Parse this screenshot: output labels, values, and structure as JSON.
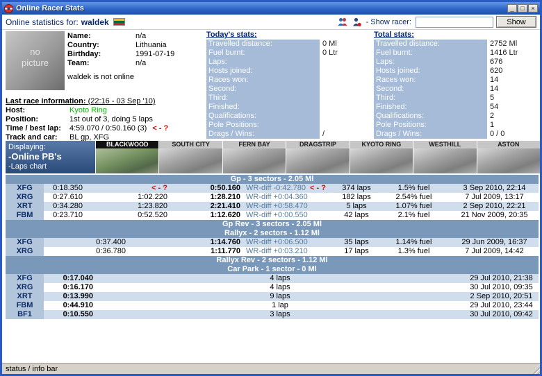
{
  "window": {
    "title": "Online Racer Stats",
    "min_label": "_",
    "max_label": "□",
    "close_label": "×"
  },
  "toolbar": {
    "label": "Online statistics for:",
    "racer_name": "waldek",
    "show_racer_label": "- Show racer:",
    "search_value": "",
    "show_button_label": "Show"
  },
  "profile": {
    "no_picture_line1": "no",
    "no_picture_line2": "picture",
    "fields": [
      {
        "label": "Name:",
        "value": "n/a"
      },
      {
        "label": "Country:",
        "value": "Lithuania"
      },
      {
        "label": "Birthday:",
        "value": "1991-07-19"
      },
      {
        "label": "Team:",
        "value": "n/a"
      }
    ],
    "online_status": "waldek is not online"
  },
  "last_race": {
    "title": "Last race information:",
    "timestamp": "(22:16 - 03 Sep '10)",
    "host_label": "Host:",
    "host_value": "Kyoto Ring",
    "position_label": "Position:",
    "position_value": "1st out of 3, doing 5 laps",
    "time_label": "Time / best lap:",
    "time_value": "4:59.070 / 0:50.160 (3)",
    "time_annotation": "< - ?",
    "track_label": "Track and car:",
    "track_value": "BL gp, XFG"
  },
  "todays_stats": {
    "title": "Today's stats:",
    "rows": [
      {
        "label": "Travelled distance:",
        "value": "0 Ml"
      },
      {
        "label": "Fuel burnt:",
        "value": "0 Ltr"
      },
      {
        "label": "Laps:",
        "value": ""
      },
      {
        "label": "Hosts joined:",
        "value": ""
      },
      {
        "label": "Races won:",
        "value": ""
      },
      {
        "label": "Second:",
        "value": ""
      },
      {
        "label": "Third:",
        "value": ""
      },
      {
        "label": "Finished:",
        "value": ""
      },
      {
        "label": "Qualifications:",
        "value": ""
      },
      {
        "label": "Pole Positions:",
        "value": ""
      },
      {
        "label": "Drags / Wins:",
        "value": "/"
      }
    ]
  },
  "total_stats": {
    "title": "Total stats:",
    "rows": [
      {
        "label": "Travelled distance:",
        "value": "2752 Ml"
      },
      {
        "label": "Fuel burnt:",
        "value": "1416 Ltr"
      },
      {
        "label": "Laps:",
        "value": "676"
      },
      {
        "label": "Hosts joined:",
        "value": "620"
      },
      {
        "label": "Races won:",
        "value": "14"
      },
      {
        "label": "Second:",
        "value": "14"
      },
      {
        "label": "Third:",
        "value": "5"
      },
      {
        "label": "Finished:",
        "value": "54"
      },
      {
        "label": "Qualifications:",
        "value": "2"
      },
      {
        "label": "Pole Positions:",
        "value": "1"
      },
      {
        "label": "Drags / Wins:",
        "value": "0 / 0"
      }
    ]
  },
  "displaying": {
    "label": "Displaying:",
    "item1": "-Online PB's",
    "item2": "-Laps chart"
  },
  "tracks": [
    {
      "name": "BLACKWOOD"
    },
    {
      "name": "SOUTH CITY"
    },
    {
      "name": "FERN BAY"
    },
    {
      "name": "DRAGSTRIP"
    },
    {
      "name": "KYOTO RING"
    },
    {
      "name": "WESTHILL"
    },
    {
      "name": "ASTON"
    }
  ],
  "results": {
    "sections": [
      {
        "header": "Gp - 3 sectors - 2.05 Ml",
        "rows": [
          {
            "car": "XFG",
            "s1": "0:18.350",
            "s2": "",
            "s2_annotation": "< - ?",
            "lap": "0:50.160",
            "wr": "WR-diff -0:42.780",
            "wr_annotation": "< - ?",
            "laps": "374 laps",
            "fuel": "1.5% fuel",
            "date": "3 Sep 2010, 22:14"
          },
          {
            "car": "XRG",
            "s1": "0:27.610",
            "s2": "1:02.220",
            "lap": "1:28.210",
            "wr": "WR-diff +0:04.360",
            "laps": "182 laps",
            "fuel": "2.54% fuel",
            "date": "7 Jul 2009, 13:17"
          },
          {
            "car": "XRT",
            "s1": "0:34.280",
            "s2": "1:23.820",
            "lap": "2:21.410",
            "wr": "WR-diff +0:58.470",
            "laps": "5 laps",
            "fuel": "1.07% fuel",
            "date": "2 Sep 2010, 22:21"
          },
          {
            "car": "FBM",
            "s1": "0:23.710",
            "s2": "0:52.520",
            "lap": "1:12.620",
            "wr": "WR-diff +0:00.550",
            "laps": "42 laps",
            "fuel": "2.1% fuel",
            "date": "21 Nov 2009, 20:35"
          }
        ]
      },
      {
        "header": "Gp Rev - 3 sectors - 2.05 Ml",
        "rows": []
      },
      {
        "header": "Rallyx - 2 sectors - 1.12 Ml",
        "rows": [
          {
            "car": "XFG",
            "s1": "0:37.400",
            "lap": "1:14.760",
            "wr": "WR-diff +0:06.500",
            "laps": "35 laps",
            "fuel": "1.14% fuel",
            "date": "29 Jun 2009, 16:37"
          },
          {
            "car": "XRG",
            "s1": "0:36.780",
            "lap": "1:11.770",
            "wr": "WR-diff +0:03.210",
            "laps": "17 laps",
            "fuel": "1.3% fuel",
            "date": "7 Jul 2009, 14:42"
          }
        ]
      },
      {
        "header": "Rallyx Rev - 2 sectors - 1.12 Ml",
        "rows": []
      },
      {
        "header": "Car Park - 1 sector - 0 Ml",
        "rows": [
          {
            "car": "XFG",
            "lap": "0:17.040",
            "laps": "4 laps",
            "date": "29 Jul 2010, 21:38"
          },
          {
            "car": "XRG",
            "lap": "0:16.170",
            "laps": "4 laps",
            "date": "30 Jul 2010, 09:35"
          },
          {
            "car": "XRT",
            "lap": "0:13.990",
            "laps": "9 laps",
            "date": "2 Sep 2010, 20:51"
          },
          {
            "car": "FBM",
            "lap": "0:44.910",
            "laps": "1 lap",
            "date": "29 Jul 2010, 23:44"
          },
          {
            "car": "BF1",
            "lap": "0:10.550",
            "laps": "3 laps",
            "date": "30 Jul 2010, 09:42"
          }
        ]
      }
    ]
  },
  "statusbar": {
    "text": "status / info bar"
  },
  "colors": {
    "titlebar_blue": "#2f66c8",
    "stat_label_bg": "#a5bbd8",
    "section_header_bg": "#7a99ba",
    "row_alt_bg": "#cfdded",
    "car_cell_bg": "#b3c5db",
    "annotation_red": "#e50000",
    "host_green": "#00bb00"
  }
}
